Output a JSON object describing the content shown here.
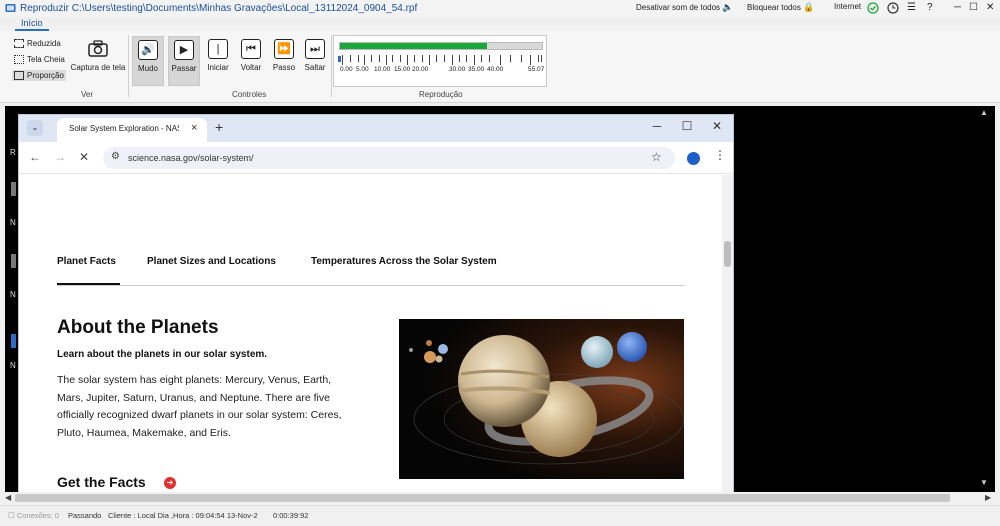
{
  "window": {
    "title": "Reproduzir C:\\Users\\testing\\Documents\\Minhas Gravações\\Local_13112024_0904_54.rpf",
    "mute_all": "Desativar som de todos",
    "lock_all": "Bloquear todos",
    "internet": "Internet"
  },
  "ribbon": {
    "tab": "Início",
    "view_group": {
      "label": "Ver",
      "items": [
        "Reduzida",
        "Tela Cheia",
        "Proporção"
      ]
    },
    "buttons": {
      "capture": "Captura de tela",
      "mute": "Mudo",
      "pass": "Passar",
      "start": "Iniciar",
      "back": "Voltar",
      "step": "Passo",
      "skip": "Saltar"
    },
    "controls_label": "Controles",
    "playback_label": "Reprodução",
    "progress_fraction": 0.73,
    "timeline_labels": [
      "0.00",
      "5.00",
      "10.00",
      "15.00",
      "20.00",
      "30.00",
      "35.00",
      "40.00",
      "55.07"
    ]
  },
  "browser": {
    "tab_title": "Solar System Exploration - NAS",
    "url": "science.nasa.gov/solar-system/"
  },
  "page": {
    "nav_tabs": [
      "Planet Facts",
      "Planet Sizes and Locations",
      "Temperatures Across the Solar System"
    ],
    "heading": "About the Planets",
    "subtitle": "Learn about the planets in our solar system.",
    "body": "The solar system has eight planets: Mercury, Venus, Earth, Mars, Jupiter, Saturn, Uranus, and Neptune. There are five officially recognized dwarf planets in our solar system: Ceres, Pluto, Haumea, Makemake, and Eris.",
    "facts_link": "Get the Facts"
  },
  "status": {
    "connections": "Conexões: 0",
    "state": "Passando",
    "client": "Cliente : Local Dia ,Hora : 09:04:54  13-Nov-2",
    "elapsed": "0:00:39:92"
  },
  "colors": {
    "progress": "#1aa83a",
    "accent": "#1a4f9c",
    "facts_arrow": "#e0312f"
  }
}
